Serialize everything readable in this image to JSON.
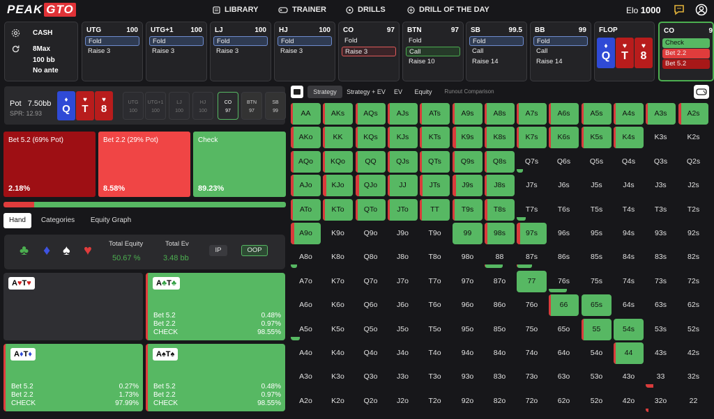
{
  "logo": {
    "peak": "PEAK",
    "gto": "GTO"
  },
  "nav": {
    "library": "LIBRARY",
    "trainer": "TRAINER",
    "drills": "DRILLS",
    "drill_of_day": "DRILL OF THE DAY"
  },
  "elo": {
    "label": "Elo",
    "value": "1000"
  },
  "game": {
    "type": "CASH",
    "format": "8Max",
    "stack": "100 bb",
    "ante": "No ante"
  },
  "positions": [
    {
      "name": "UTG",
      "stack": "100",
      "actions": [
        "Fold",
        "Raise 3"
      ],
      "selected": 0
    },
    {
      "name": "UTG+1",
      "stack": "100",
      "actions": [
        "Fold",
        "Raise 3"
      ],
      "selected": 0
    },
    {
      "name": "LJ",
      "stack": "100",
      "actions": [
        "Fold",
        "Raise 3"
      ],
      "selected": 0
    },
    {
      "name": "HJ",
      "stack": "100",
      "actions": [
        "Fold",
        "Raise 3"
      ],
      "selected": 0
    },
    {
      "name": "CO",
      "stack": "97",
      "actions": [
        "Fold",
        "Raise 3"
      ],
      "selected": 1
    },
    {
      "name": "BTN",
      "stack": "97",
      "actions": [
        "Fold",
        "Call",
        "Raise 10"
      ],
      "selected": 1
    },
    {
      "name": "SB",
      "stack": "99.5",
      "actions": [
        "Fold",
        "Call",
        "Raise 14"
      ],
      "selected": 0
    },
    {
      "name": "BB",
      "stack": "99",
      "actions": [
        "Fold",
        "Call",
        "Raise 14"
      ],
      "selected": 0
    }
  ],
  "flop": {
    "label": "FLOP",
    "cards": [
      {
        "rank": "Q",
        "suit": "♦"
      },
      {
        "rank": "T",
        "suit": "♥"
      },
      {
        "rank": "8",
        "suit": "♥"
      }
    ]
  },
  "co_panel": {
    "name": "CO",
    "stack": "9",
    "actions": [
      "Check",
      "Bet 2.2",
      "Bet 5.2"
    ]
  },
  "pot": {
    "label": "Pot",
    "value": "7.50bb",
    "spr": "SPR: 12.93"
  },
  "seats": [
    {
      "name": "UTG",
      "stack": "100"
    },
    {
      "name": "UTG+1",
      "stack": "100"
    },
    {
      "name": "LJ",
      "stack": "100"
    },
    {
      "name": "HJ",
      "stack": "100"
    },
    {
      "name": "CO",
      "stack": "97"
    },
    {
      "name": "BTN",
      "stack": "97"
    },
    {
      "name": "SB",
      "stack": "99"
    }
  ],
  "actions": [
    {
      "label": "Bet 5.2 (69% Pot)",
      "pct": "2.18%",
      "color": "#9e0f14"
    },
    {
      "label": "Bet 2.2 (29% Pot)",
      "pct": "8.58%",
      "color": "#f04545"
    },
    {
      "label": "Check",
      "pct": "89.23%",
      "color": "#57b863"
    }
  ],
  "action_bar": [
    0.1076,
    0.8924
  ],
  "sub_tabs": [
    "Hand",
    "Categories",
    "Equity Graph"
  ],
  "equity": {
    "total_equity_label": "Total Equity",
    "total_equity": "50.67 %",
    "total_ev_label": "Total Ev",
    "total_ev": "3.48 bb",
    "ip": "IP",
    "oop": "OOP"
  },
  "suits": [
    "♣",
    "♦",
    "♠",
    "♥"
  ],
  "hands": [
    {
      "label": "A♥T♥",
      "rows": []
    },
    {
      "label": "A♣T♣",
      "rows": [
        [
          "Bet 5.2",
          "0.48%"
        ],
        [
          "Bet 2.2",
          "0.97%"
        ],
        [
          "CHECK",
          "98.55%"
        ]
      ]
    },
    {
      "label": "A♦T♦",
      "rows": [
        [
          "Bet 5.2",
          "0.27%"
        ],
        [
          "Bet 2.2",
          "1.73%"
        ],
        [
          "CHECK",
          "97.99%"
        ]
      ]
    },
    {
      "label": "A♠T♠",
      "rows": [
        [
          "Bet 5.2",
          "0.48%"
        ],
        [
          "Bet 2.2",
          "0.97%"
        ],
        [
          "CHECK",
          "98.55%"
        ]
      ]
    }
  ],
  "view_tabs": [
    "Strategy",
    "Strategy + EV",
    "EV",
    "Equity",
    "Runout Comparison"
  ],
  "grid": {
    "ranks": [
      "A",
      "K",
      "Q",
      "J",
      "T",
      "9",
      "8",
      "7",
      "6",
      "5",
      "4",
      "3",
      "2"
    ],
    "cells": [
      [
        "AA",
        1,
        0.08
      ],
      [
        "AKs",
        1,
        0.08
      ],
      [
        "AQs",
        1,
        0.08
      ],
      [
        "AJs",
        1,
        0.05
      ],
      [
        "ATs",
        1,
        0.02
      ],
      [
        "A9s",
        1,
        0.08
      ],
      [
        "A8s",
        1,
        0.04
      ],
      [
        "A7s",
        1,
        0.04
      ],
      [
        "A6s",
        1,
        0.04
      ],
      [
        "A5s",
        1,
        0.04
      ],
      [
        "A4s",
        1,
        0.04
      ],
      [
        "A3s",
        1,
        0.08
      ],
      [
        "A2s",
        1,
        0.1
      ],
      [
        "AKo",
        1,
        0.1
      ],
      [
        "KK",
        1,
        0.05
      ],
      [
        "KQs",
        1,
        0.08
      ],
      [
        "KJs",
        1,
        0.05
      ],
      [
        "KTs",
        1,
        0.02
      ],
      [
        "K9s",
        1,
        0.12
      ],
      [
        "K8s",
        1,
        0.05
      ],
      [
        "K7s",
        1,
        0.05
      ],
      [
        "K6s",
        1,
        0.05
      ],
      [
        "K5s",
        1,
        0.05
      ],
      [
        "K4s",
        1,
        0.05
      ],
      [
        "K3s",
        0,
        0
      ],
      [
        "K2s",
        0,
        0
      ],
      [
        "AQo",
        1,
        0.1
      ],
      [
        "KQo",
        1,
        0.06
      ],
      [
        "QQ",
        1,
        0.03
      ],
      [
        "QJs",
        1,
        0.06
      ],
      [
        "QTs",
        1,
        0.03
      ],
      [
        "Q9s",
        1,
        0.08
      ],
      [
        "Q8s",
        1,
        0.06
      ],
      [
        "Q7s",
        0.2,
        0
      ],
      [
        "Q6s",
        0,
        0
      ],
      [
        "Q5s",
        0,
        0
      ],
      [
        "Q4s",
        0,
        0
      ],
      [
        "Q3s",
        0,
        0
      ],
      [
        "Q2s",
        0,
        0
      ],
      [
        "AJo",
        1,
        0.1
      ],
      [
        "KJo",
        1,
        0.12
      ],
      [
        "QJo",
        1,
        0.12
      ],
      [
        "JJ",
        1,
        0.05
      ],
      [
        "JTs",
        1,
        0.1
      ],
      [
        "J9s",
        1,
        0.12
      ],
      [
        "J8s",
        1,
        0.06
      ],
      [
        "J7s",
        0,
        0
      ],
      [
        "J6s",
        0,
        0
      ],
      [
        "J5s",
        0,
        0
      ],
      [
        "J4s",
        0,
        0
      ],
      [
        "J3s",
        0,
        0
      ],
      [
        "J2s",
        0,
        0
      ],
      [
        "ATo",
        1,
        0.05
      ],
      [
        "KTo",
        1,
        0.05
      ],
      [
        "QTo",
        1,
        0.05
      ],
      [
        "JTo",
        1,
        0.05
      ],
      [
        "TT",
        1,
        0.02
      ],
      [
        "T9s",
        1,
        0.08
      ],
      [
        "T8s",
        1,
        0.1
      ],
      [
        "T7s",
        0.3,
        0
      ],
      [
        "T6s",
        0,
        0
      ],
      [
        "T5s",
        0,
        0
      ],
      [
        "T4s",
        0,
        0
      ],
      [
        "T3s",
        0,
        0
      ],
      [
        "T2s",
        0,
        0
      ],
      [
        "A9o",
        1,
        0.12
      ],
      [
        "K9o",
        0,
        0
      ],
      [
        "Q9o",
        0,
        0
      ],
      [
        "J9o",
        0,
        0
      ],
      [
        "T9o",
        0,
        0
      ],
      [
        "99",
        1,
        0
      ],
      [
        "98s",
        1,
        0.1
      ],
      [
        "97s",
        1,
        0.12
      ],
      [
        "96s",
        0,
        0
      ],
      [
        "95s",
        0,
        0
      ],
      [
        "94s",
        0,
        0
      ],
      [
        "93s",
        0,
        0
      ],
      [
        "92s",
        0,
        0
      ],
      [
        "A8o",
        0.2,
        0
      ],
      [
        "K8o",
        0,
        0
      ],
      [
        "Q8o",
        0,
        0
      ],
      [
        "J8o",
        0,
        0
      ],
      [
        "T8o",
        0,
        0
      ],
      [
        "98o",
        0,
        0
      ],
      [
        "88",
        0.6,
        0.02
      ],
      [
        "87s",
        0.5,
        0.03
      ],
      [
        "86s",
        0,
        0
      ],
      [
        "85s",
        0,
        0
      ],
      [
        "84s",
        0,
        0
      ],
      [
        "83s",
        0,
        0
      ],
      [
        "82s",
        0,
        0
      ],
      [
        "A7o",
        0,
        0
      ],
      [
        "K7o",
        0,
        0
      ],
      [
        "Q7o",
        0,
        0
      ],
      [
        "J7o",
        0,
        0
      ],
      [
        "T7o",
        0,
        0
      ],
      [
        "97o",
        0,
        0
      ],
      [
        "87o",
        0,
        0
      ],
      [
        "77",
        1,
        0
      ],
      [
        "76s",
        0.6,
        0
      ],
      [
        "75s",
        0,
        0
      ],
      [
        "74s",
        0,
        0
      ],
      [
        "73s",
        0,
        0
      ],
      [
        "72s",
        0,
        0
      ],
      [
        "A6o",
        0,
        0
      ],
      [
        "K6o",
        0,
        0
      ],
      [
        "Q6o",
        0,
        0
      ],
      [
        "J6o",
        0,
        0
      ],
      [
        "T6o",
        0,
        0
      ],
      [
        "96o",
        0,
        0
      ],
      [
        "86o",
        0,
        0
      ],
      [
        "76o",
        0,
        0
      ],
      [
        "66",
        1,
        0.04
      ],
      [
        "65s",
        1,
        0
      ],
      [
        "64s",
        0,
        0
      ],
      [
        "63s",
        0,
        0
      ],
      [
        "62s",
        0,
        0
      ],
      [
        "A5o",
        0.3,
        0
      ],
      [
        "K5o",
        0,
        0
      ],
      [
        "Q5o",
        0,
        0
      ],
      [
        "J5o",
        0,
        0
      ],
      [
        "T5o",
        0,
        0
      ],
      [
        "95o",
        0,
        0
      ],
      [
        "85o",
        0,
        0
      ],
      [
        "75o",
        0,
        0
      ],
      [
        "65o",
        0,
        0
      ],
      [
        "55",
        1,
        0.05
      ],
      [
        "54s",
        1,
        0
      ],
      [
        "53s",
        0,
        0
      ],
      [
        "52s",
        0,
        0
      ],
      [
        "A4o",
        0,
        0
      ],
      [
        "K4o",
        0,
        0
      ],
      [
        "Q4o",
        0,
        0
      ],
      [
        "J4o",
        0,
        0
      ],
      [
        "T4o",
        0,
        0
      ],
      [
        "94o",
        0,
        0
      ],
      [
        "84o",
        0,
        0
      ],
      [
        "74o",
        0,
        0
      ],
      [
        "64o",
        0,
        0
      ],
      [
        "54o",
        0,
        0
      ],
      [
        "44",
        1,
        0.05
      ],
      [
        "43s",
        0,
        0
      ],
      [
        "42s",
        0,
        0
      ],
      [
        "A3o",
        0,
        0
      ],
      [
        "K3o",
        0,
        0
      ],
      [
        "Q3o",
        0,
        0
      ],
      [
        "J3o",
        0,
        0
      ],
      [
        "T3o",
        0,
        0
      ],
      [
        "93o",
        0,
        0
      ],
      [
        "83o",
        0,
        0
      ],
      [
        "73o",
        0,
        0
      ],
      [
        "63o",
        0,
        0
      ],
      [
        "53o",
        0,
        0
      ],
      [
        "43o",
        0,
        0
      ],
      [
        "33",
        0.25,
        0.25
      ],
      [
        "32s",
        0,
        0
      ],
      [
        "A2o",
        0,
        0
      ],
      [
        "K2o",
        0,
        0
      ],
      [
        "Q2o",
        0,
        0
      ],
      [
        "J2o",
        0,
        0
      ],
      [
        "T2o",
        0,
        0
      ],
      [
        "92o",
        0,
        0
      ],
      [
        "82o",
        0,
        0
      ],
      [
        "72o",
        0,
        0
      ],
      [
        "62o",
        0,
        0
      ],
      [
        "52o",
        0,
        0
      ],
      [
        "42o",
        0,
        0
      ],
      [
        "32o",
        0.05,
        0.1
      ],
      [
        "22",
        0,
        0
      ]
    ]
  },
  "colors": {
    "bg": "#17171a",
    "green": "#57b863",
    "red": "#d93b3b",
    "darkred": "#9e0f14",
    "panel": "#232326"
  }
}
